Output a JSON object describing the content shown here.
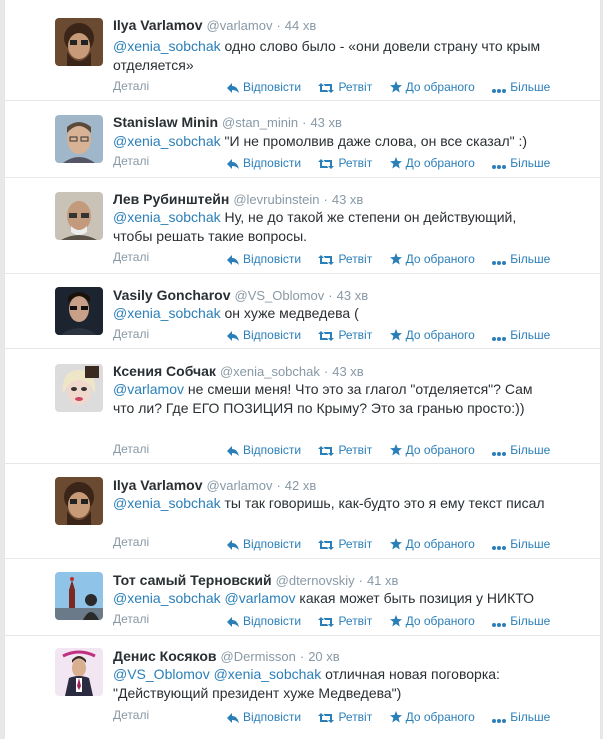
{
  "actions": {
    "reply": "Відповісти",
    "retweet": "Ретвіт",
    "favorite": "До обраного",
    "more": "Більше"
  },
  "details_label": "Деталі",
  "tweets": [
    {
      "name": "Ilya Varlamov",
      "handle": "@varlamov",
      "time": "44 хв",
      "mention": "@xenia_sobchak",
      "mention2": "",
      "text": "одно слово было - «они довели страну что крым отделяется»"
    },
    {
      "name": "Stanislaw Minin",
      "handle": "@stan_minin",
      "time": "43 хв",
      "mention": "@xenia_sobchak",
      "mention2": "",
      "text": "\"И не промолвив даже слова, он все сказал\" :)"
    },
    {
      "name": "Лев Рубинштейн",
      "handle": "@levrubinstein",
      "time": "43 хв",
      "mention": "@xenia_sobchak",
      "mention2": "",
      "text": "Ну, не до такой же степени он действующий, чтобы решать такие вопросы."
    },
    {
      "name": "Vasily Goncharov",
      "handle": "@VS_Oblomov",
      "time": "43 хв",
      "mention": "@xenia_sobchak",
      "mention2": "",
      "text": "он хуже медведева ("
    },
    {
      "name": "Ксения Собчак",
      "handle": "@xenia_sobchak",
      "time": "43 хв",
      "mention": "@varlamov",
      "mention2": "",
      "text": "не смеши меня! Что это за глагол  \"отделяется\"? Сам что ли? Где ЕГО ПОЗИЦИЯ по Крыму? Это за гранью просто:))"
    },
    {
      "name": "Ilya Varlamov",
      "handle": "@varlamov",
      "time": "42 хв",
      "mention": "@xenia_sobchak",
      "mention2": "",
      "text": "ты так говоришь, как-будто это я ему текст писал"
    },
    {
      "name": "Тот самый Терновский",
      "handle": "@dternovskiy",
      "time": "41 хв",
      "mention": "@xenia_sobchak",
      "mention2": "@varlamov",
      "text": "какая может быть позиция у НИКТО"
    },
    {
      "name": "Денис Косяков",
      "handle": "@Dermisson",
      "time": "20 хв",
      "mention": "@VS_Oblomov",
      "mention2": "@xenia_sobchak",
      "text": "отличная новая поговорка: \"Действующий президент хуже Медведева\")"
    }
  ]
}
